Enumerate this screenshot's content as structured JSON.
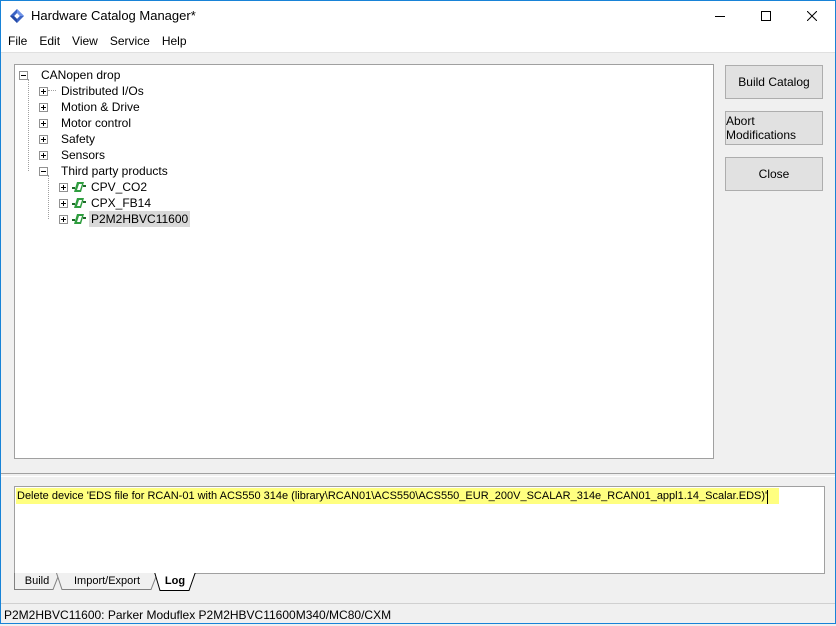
{
  "window": {
    "title": "Hardware Catalog Manager*",
    "accent": "#1883d7"
  },
  "menu": [
    "File",
    "Edit",
    "View",
    "Service",
    "Help"
  ],
  "tree": {
    "root": "CANopen drop",
    "categories": [
      "Distributed I/Os",
      "Motion & Drive",
      "Motor control",
      "Safety",
      "Sensors",
      "Third party products"
    ],
    "devices": [
      "CPV_CO2",
      "CPX_FB14",
      "P2M2HBVC11600"
    ],
    "selected": "P2M2HBVC11600"
  },
  "buttons": {
    "build_catalog": "Build Catalog",
    "abort_modifications": "Abort Modifications",
    "close": "Close"
  },
  "log": {
    "line": "Delete device 'EDS file for RCAN-01 with ACS550 314e (library\\RCAN01\\ACS550\\ACS550_EUR_200V_SCALAR_314e_RCAN01_appl1.14_Scalar.EDS)'",
    "highlight_color": "#ffff80"
  },
  "tabs": [
    "Build",
    "Import/Export",
    "Log"
  ],
  "active_tab": "Log",
  "status": "P2M2HBVC11600: Parker Moduflex P2M2HBVC11600M340/MC80/CXM"
}
